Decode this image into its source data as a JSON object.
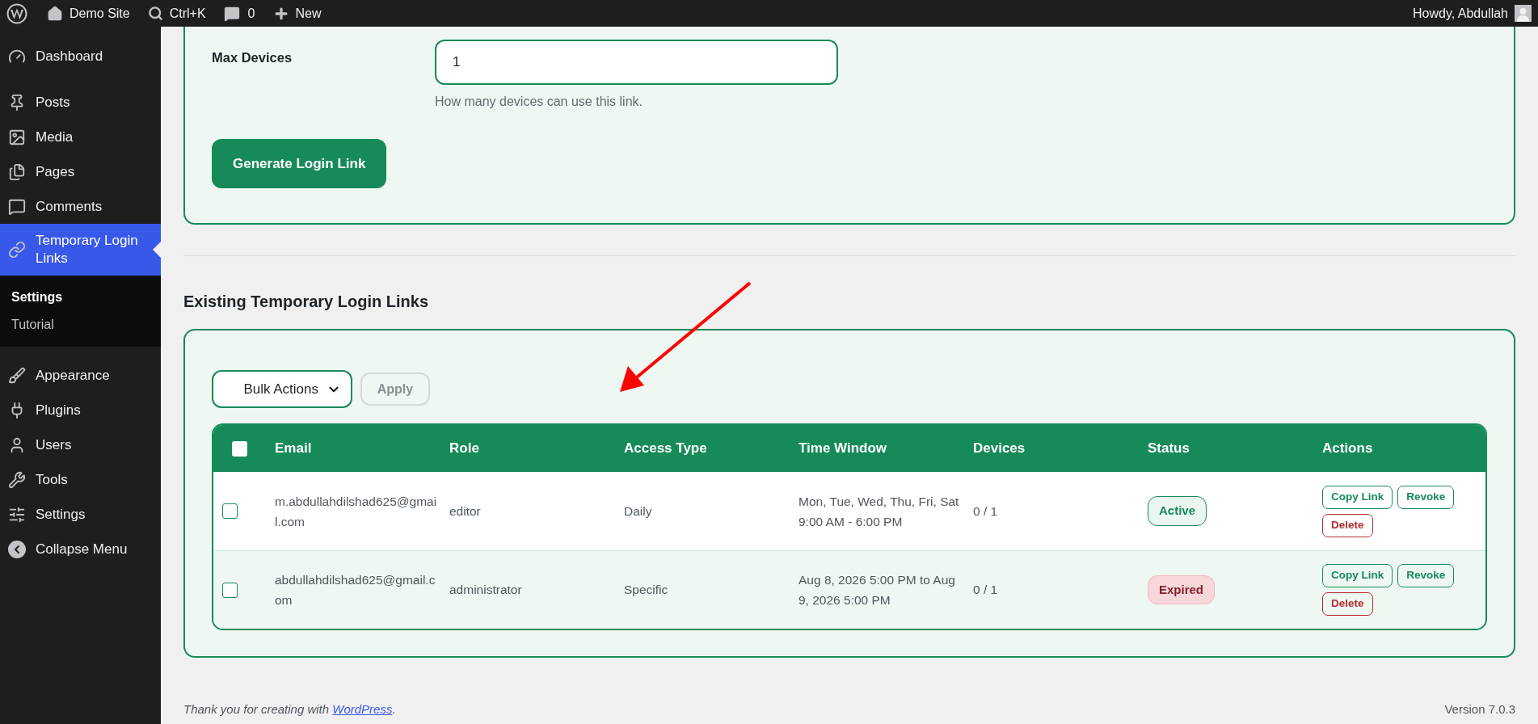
{
  "admin_bar": {
    "site": "Demo Site",
    "search": "Ctrl+K",
    "comments": "0",
    "new": "New",
    "greeting": "Howdy, Abdullah"
  },
  "sidebar": {
    "items": [
      {
        "label": "Dashboard",
        "selected": false
      },
      {
        "label": "Posts",
        "selected": false
      },
      {
        "label": "Media",
        "selected": false
      },
      {
        "label": "Pages",
        "selected": false
      },
      {
        "label": "Comments",
        "selected": false
      },
      {
        "label": "Temporary Login Links",
        "selected": true,
        "children": [
          {
            "label": "Settings",
            "selected": true
          },
          {
            "label": "Tutorial",
            "selected": false
          }
        ]
      },
      {
        "label": "Appearance",
        "selected": false
      },
      {
        "label": "Plugins",
        "selected": false
      },
      {
        "label": "Users",
        "selected": false
      },
      {
        "label": "Tools",
        "selected": false
      },
      {
        "label": "Settings",
        "selected": false
      },
      {
        "label": "Collapse Menu",
        "selected": false
      }
    ]
  },
  "form": {
    "label": "Max Devices",
    "value": "1",
    "help": "How many devices can use this link.",
    "button": "Generate Login Link"
  },
  "section_title": "Existing Temporary Login Links",
  "bulk": {
    "select": "Bulk Actions",
    "apply": "Apply",
    "apply_disabled": true
  },
  "table": {
    "select_all_checked": false,
    "columns": [
      "Email",
      "Role",
      "Access Type",
      "Time Window",
      "Devices",
      "Status",
      "Actions"
    ],
    "rows": [
      {
        "checked": false,
        "email": "m.abdullahdilshad625@gmail.com",
        "role": "editor",
        "access_type": "Daily",
        "time_window": "Mon, Tue, Wed, Thu, Fri, Sat 9:00 AM - 6:00 PM",
        "devices": "0 / 1",
        "status": {
          "label": "Active",
          "kind": "active"
        },
        "actions": [
          {
            "label": "Copy Link",
            "kind": "normal"
          },
          {
            "label": "Revoke",
            "kind": "normal"
          },
          {
            "label": "Delete",
            "kind": "danger"
          }
        ]
      },
      {
        "checked": false,
        "email": "abdullahdilshad625@gmail.com",
        "role": "administrator",
        "access_type": "Specific",
        "time_window": "Aug 8, 2026 5:00 PM to Aug 9, 2026 5:00 PM",
        "devices": "0 / 1",
        "status": {
          "label": "Expired",
          "kind": "expired"
        },
        "actions": [
          {
            "label": "Copy Link",
            "kind": "normal"
          },
          {
            "label": "Revoke",
            "kind": "normal"
          },
          {
            "label": "Delete",
            "kind": "danger"
          }
        ]
      }
    ]
  },
  "footer": {
    "text": "Thank you for creating with ",
    "link": "WordPress",
    "end": ".",
    "version": "Version 7.0.3"
  }
}
